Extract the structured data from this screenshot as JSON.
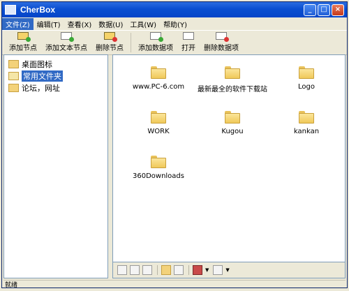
{
  "window": {
    "title": "CherBox"
  },
  "menu": [
    {
      "label": "文件(Z)"
    },
    {
      "label": "编辑(T)"
    },
    {
      "label": "查看(X)"
    },
    {
      "label": "数据(U)"
    },
    {
      "label": "工具(W)"
    },
    {
      "label": "帮助(Y)"
    }
  ],
  "toolbar": {
    "add_node": "添加节点",
    "add_text_node": "添加文本节点",
    "delete_node": "删除节点",
    "add_item": "添加数据项",
    "open": "打开",
    "delete_item": "删除数据项"
  },
  "tree": [
    {
      "label": "桌面图标"
    },
    {
      "label": "常用文件夹"
    },
    {
      "label": "论坛，网址"
    }
  ],
  "folders": [
    {
      "label": "www.PC-6.com"
    },
    {
      "label": "最新最全的软件下载站"
    },
    {
      "label": "Logo"
    },
    {
      "label": "WORK"
    },
    {
      "label": "Kugou"
    },
    {
      "label": "kankan"
    },
    {
      "label": "360Downloads"
    }
  ],
  "status": {
    "text": "就绪"
  }
}
